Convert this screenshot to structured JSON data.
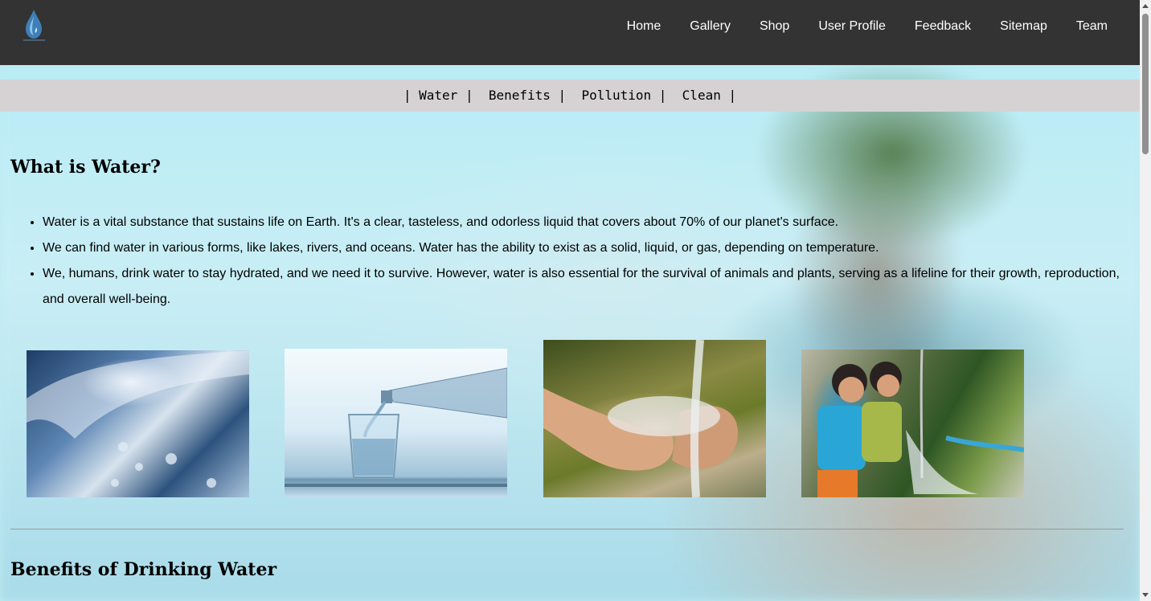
{
  "nav": {
    "items": [
      "Home",
      "Gallery",
      "Shop",
      "User Profile",
      "Feedback",
      "Sitemap",
      "Team"
    ]
  },
  "subnav": {
    "items": [
      "Water",
      "Benefits",
      "Pollution",
      "Clean"
    ]
  },
  "section_water": {
    "heading": "What is Water?",
    "bullets": [
      "Water is a vital substance that sustains life on Earth. It's a clear, tasteless, and odorless liquid that covers about 70% of our planet's surface.",
      "We can find water in various forms, like lakes, rivers, and oceans. Water has the ability to exist as a solid, liquid, or gas, depending on temperature.",
      "We, humans, drink water to stay hydrated, and we need it to survive. However, water is also essential for the survival of animals and plants, serving as a lifeline for their growth, reproduction, and overall well-being."
    ]
  },
  "section_benefits": {
    "heading": "Benefits of Drinking Water"
  },
  "colors": {
    "topbar": "#333333",
    "subnav": "#d6d2d3"
  }
}
